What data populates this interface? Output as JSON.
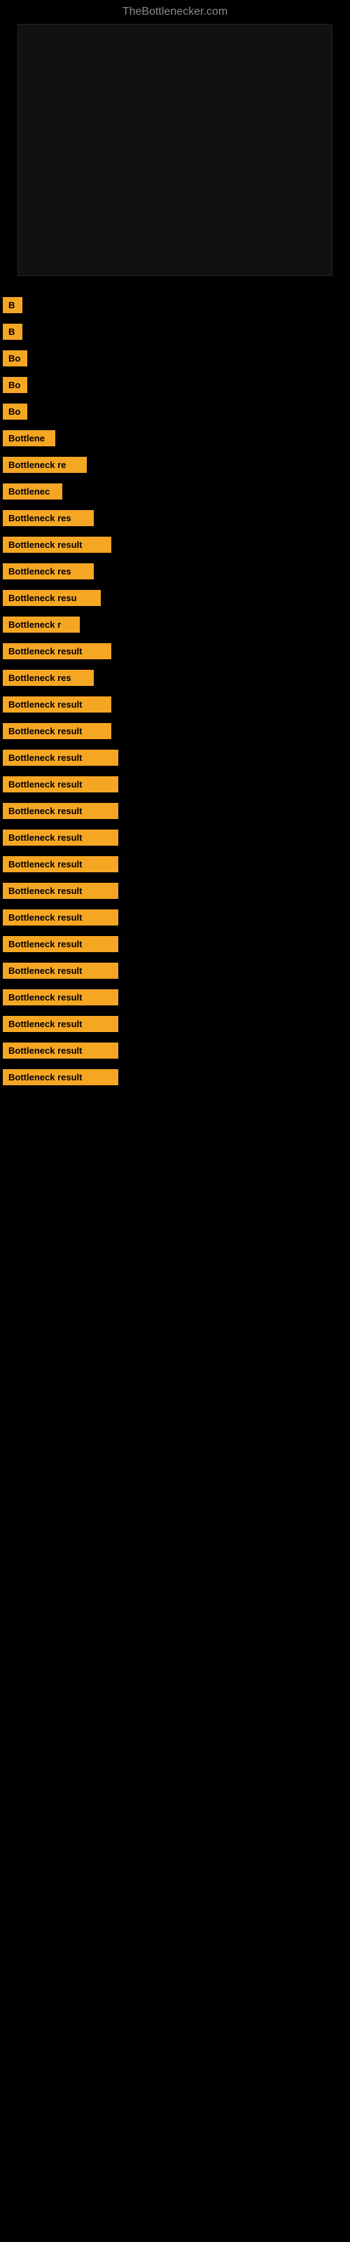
{
  "site": {
    "title": "TheBottlenecker.com"
  },
  "results": [
    {
      "id": 1,
      "label": "B",
      "width": 28
    },
    {
      "id": 2,
      "label": "B",
      "width": 28
    },
    {
      "id": 3,
      "label": "Bo",
      "width": 35
    },
    {
      "id": 4,
      "label": "Bo",
      "width": 35
    },
    {
      "id": 5,
      "label": "Bo",
      "width": 35
    },
    {
      "id": 6,
      "label": "Bottlene",
      "width": 75
    },
    {
      "id": 7,
      "label": "Bottleneck re",
      "width": 120
    },
    {
      "id": 8,
      "label": "Bottlenec",
      "width": 85
    },
    {
      "id": 9,
      "label": "Bottleneck res",
      "width": 130
    },
    {
      "id": 10,
      "label": "Bottleneck result",
      "width": 155
    },
    {
      "id": 11,
      "label": "Bottleneck res",
      "width": 130
    },
    {
      "id": 12,
      "label": "Bottleneck resu",
      "width": 140
    },
    {
      "id": 13,
      "label": "Bottleneck r",
      "width": 110
    },
    {
      "id": 14,
      "label": "Bottleneck result",
      "width": 155
    },
    {
      "id": 15,
      "label": "Bottleneck res",
      "width": 130
    },
    {
      "id": 16,
      "label": "Bottleneck result",
      "width": 155
    },
    {
      "id": 17,
      "label": "Bottleneck result",
      "width": 155
    },
    {
      "id": 18,
      "label": "Bottleneck result",
      "width": 165
    },
    {
      "id": 19,
      "label": "Bottleneck result",
      "width": 165
    },
    {
      "id": 20,
      "label": "Bottleneck result",
      "width": 165
    },
    {
      "id": 21,
      "label": "Bottleneck result",
      "width": 165
    },
    {
      "id": 22,
      "label": "Bottleneck result",
      "width": 165
    },
    {
      "id": 23,
      "label": "Bottleneck result",
      "width": 165
    },
    {
      "id": 24,
      "label": "Bottleneck result",
      "width": 165
    },
    {
      "id": 25,
      "label": "Bottleneck result",
      "width": 165
    },
    {
      "id": 26,
      "label": "Bottleneck result",
      "width": 165
    },
    {
      "id": 27,
      "label": "Bottleneck result",
      "width": 165
    },
    {
      "id": 28,
      "label": "Bottleneck result",
      "width": 165
    },
    {
      "id": 29,
      "label": "Bottleneck result",
      "width": 165
    },
    {
      "id": 30,
      "label": "Bottleneck result",
      "width": 165
    }
  ],
  "colors": {
    "background": "#000000",
    "badge": "#f5a623",
    "text_primary": "#888888"
  }
}
